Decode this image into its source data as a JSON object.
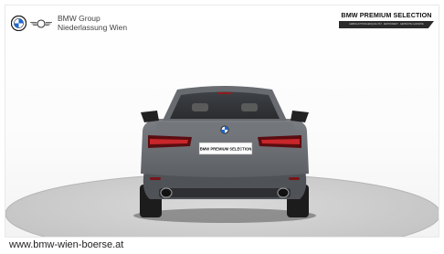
{
  "brand": {
    "name_line1": "BMW Group",
    "name_line2": "Niederlassung Wien",
    "roundel_icon": "bmw-roundel-icon",
    "mini_icon": "mini-wing-icon"
  },
  "badge": {
    "title": "BMW PREMIUM SELECTION",
    "strip_text": "GEBRAUCHTWAGENQUALITÄT · ZERTIFIZIERT · GEPRÜFTE GARANTIE"
  },
  "vehicle": {
    "plate_text": "BMW PREMIUM SELECTION",
    "paint_color": "#6f7277"
  },
  "footer": {
    "url": "www.bmw-wien-boerse.at"
  }
}
